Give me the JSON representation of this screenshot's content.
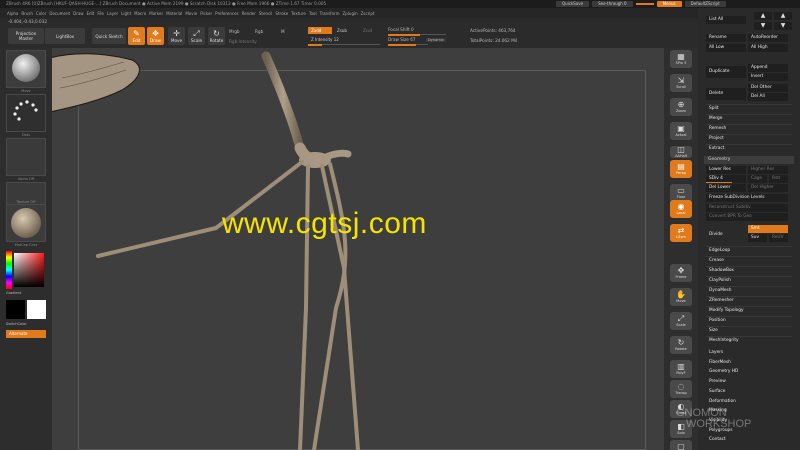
{
  "app": {
    "title": "ZBrush 4R6 [0]ZBrush [HKUF-QASH-HUGE-...] ZBrush Document  ● Active Mem 2199 ● Scratch Disk 10313 ● Free Mem 1966 ● ZTime 1.67 Timer 0.005",
    "quicksave": "QuickSave",
    "see_through": "See-through 0",
    "menus": "Menus",
    "default_script": "DefaultZScript"
  },
  "menubar": [
    "Alpha",
    "Brush",
    "Color",
    "Document",
    "Draw",
    "Edit",
    "File",
    "Layer",
    "Light",
    "Macro",
    "Marker",
    "Material",
    "Movie",
    "Picker",
    "Preferences",
    "Render",
    "Stencil",
    "Stroke",
    "Texture",
    "Tool",
    "Transform",
    "Zplugin",
    "Zscript"
  ],
  "coords": "-0.404,-0.43,0.032",
  "toolbar": {
    "projection_master": "Projection Master",
    "lightbox": "LightBox",
    "quick_sketch": "Quick Sketch",
    "edit": "Edit",
    "draw": "Draw",
    "move": "Move",
    "scale": "Scale",
    "rotate": "Rotate",
    "mrgb": "Mrgb",
    "rgb": "Rgb",
    "m": "M",
    "rgb_intensity": "Rgb Intensity",
    "zadd": "Zadd",
    "zsub": "Zsub",
    "zcut": "Zcut",
    "z_intensity": "Z Intensity 12",
    "focal_shift": "Focal Shift 0",
    "draw_size": "Draw Size 67",
    "dynamic": "Dynamic",
    "active_points": "ActivePoints: 463,764",
    "total_points": "TotalPoints: 24.062 Mil"
  },
  "left_shelf": {
    "brush_label": "Move",
    "stroke_label": "Dots",
    "alpha_label": "Alpha Off",
    "texture_label": "Texture Off",
    "material_label": "MatCap Gray",
    "gradient_label": "Gradient",
    "switch_color": "SwitchColor",
    "alternate": "Alternate"
  },
  "right_shelf": [
    {
      "glyph": "▦",
      "label": "SPix 3",
      "orange": false
    },
    {
      "glyph": "⇲",
      "label": "Scroll",
      "orange": false
    },
    {
      "glyph": "⊕",
      "label": "Zoom",
      "orange": false
    },
    {
      "glyph": "▣",
      "label": "Actual",
      "orange": false
    },
    {
      "glyph": "◫",
      "label": "AAHalf",
      "orange": false
    },
    {
      "glyph": "▤",
      "label": "Persp",
      "orange": true
    },
    {
      "glyph": "▭",
      "label": "Floor",
      "orange": false
    },
    {
      "glyph": "◉",
      "label": "Local",
      "orange": true
    },
    {
      "glyph": "⇄",
      "label": "LSym",
      "orange": true
    },
    {
      "glyph": "✥",
      "label": "Frame",
      "orange": false
    },
    {
      "glyph": "✋",
      "label": "Move",
      "orange": false
    },
    {
      "glyph": "⤢",
      "label": "Scale",
      "orange": false
    },
    {
      "glyph": "↻",
      "label": "Rotate",
      "orange": false
    },
    {
      "glyph": "▥",
      "label": "PolyF",
      "orange": false
    },
    {
      "glyph": "◌",
      "label": "Transp",
      "orange": false
    },
    {
      "glyph": "◐",
      "label": "Ghost",
      "orange": false
    },
    {
      "glyph": "◧",
      "label": "Solo",
      "orange": false
    },
    {
      "glyph": "▢",
      "label": "Xpose",
      "orange": false
    }
  ],
  "tray": {
    "list_all": "List All",
    "rename": "Rename",
    "auto_reorder": "AutoReorder",
    "all_low": "All Low",
    "all_high": "All High",
    "duplicate": "Duplicate",
    "append": "Append",
    "insert": "Insert",
    "delete": "Delete",
    "del_other": "Del Other",
    "del_all": "Del All",
    "split": "Split",
    "merge": "Merge",
    "remesh": "Remesh",
    "project": "Project",
    "extract": "Extract",
    "geometry_header": "Geometry",
    "lower_res": "Lower Res",
    "higher_res": "Higher Res",
    "sdiv": "SDiv 4",
    "cage": "Cage",
    "rstr": "Rstr",
    "del_lower": "Del Lower",
    "del_higher": "Del Higher",
    "freeze_subdiv": "Freeze SubDivision Levels",
    "reconstruct_subdiv": "Reconstruct Subdiv",
    "convert_bpr": "Convert BPR To Geo",
    "divide": "Divide",
    "smt": "Smt",
    "suv": "Suv",
    "reuv": "ReUV",
    "geometry_items": [
      "EdgeLoop",
      "Crease",
      "ShadowBox",
      "ClayPolish",
      "DynaMesh",
      "ZRemesher",
      "Modify Topology",
      "Position",
      "Size",
      "MeshIntegrity"
    ],
    "subpalettes": [
      "Layers",
      "FiberMesh",
      "Geometry HD",
      "Preview",
      "Surface",
      "Deformation",
      "Masking",
      "Visibility",
      "Polygroups",
      "Contact"
    ]
  },
  "watermark": "www.cgtsj.com",
  "logo": {
    "line1": "GNOMON",
    "line2": "WORKSHOP"
  },
  "colors": {
    "accent": "#e07a1a",
    "watermark": "#f5e400",
    "viewport": "#3e3e3e"
  }
}
